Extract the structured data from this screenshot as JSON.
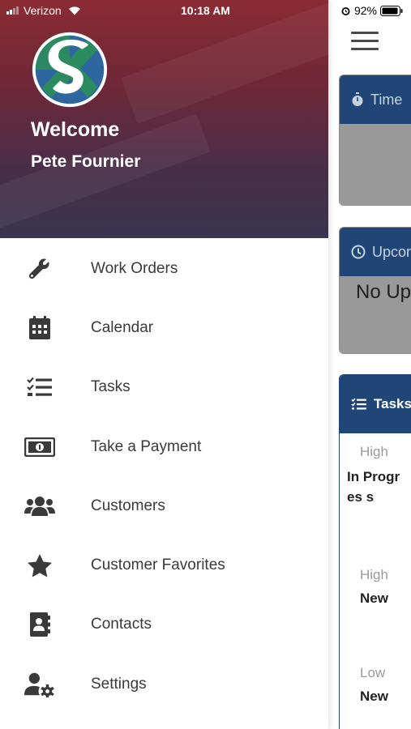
{
  "status_bar": {
    "carrier": "Verizon",
    "time": "10:18 AM",
    "battery": "92%"
  },
  "drawer": {
    "welcome": "Welcome",
    "username": "Pete Fournier",
    "items": [
      {
        "label": "Work Orders",
        "icon": "wrench-icon"
      },
      {
        "label": "Calendar",
        "icon": "calendar-icon"
      },
      {
        "label": "Tasks",
        "icon": "tasks-icon"
      },
      {
        "label": "Take a Payment",
        "icon": "money-icon"
      },
      {
        "label": "Customers",
        "icon": "users-icon"
      },
      {
        "label": "Customer Favorites",
        "icon": "star-icon"
      },
      {
        "label": "Contacts",
        "icon": "address-book-icon"
      },
      {
        "label": "Settings",
        "icon": "user-cog-icon"
      }
    ]
  },
  "background": {
    "time_card_title": "Time",
    "upcoming_card_title": "Upcom",
    "upcoming_empty": "No Up",
    "tasks_title": "Tasks",
    "tasks": [
      {
        "priority": "High",
        "status": "In Progres s"
      },
      {
        "priority": "High",
        "status": "New"
      },
      {
        "priority": "Low",
        "status": "New"
      }
    ]
  },
  "colors": {
    "card_header": "#1f4676",
    "drawer_header_top": "#8b2b33",
    "drawer_header_bottom": "#3a3550"
  }
}
